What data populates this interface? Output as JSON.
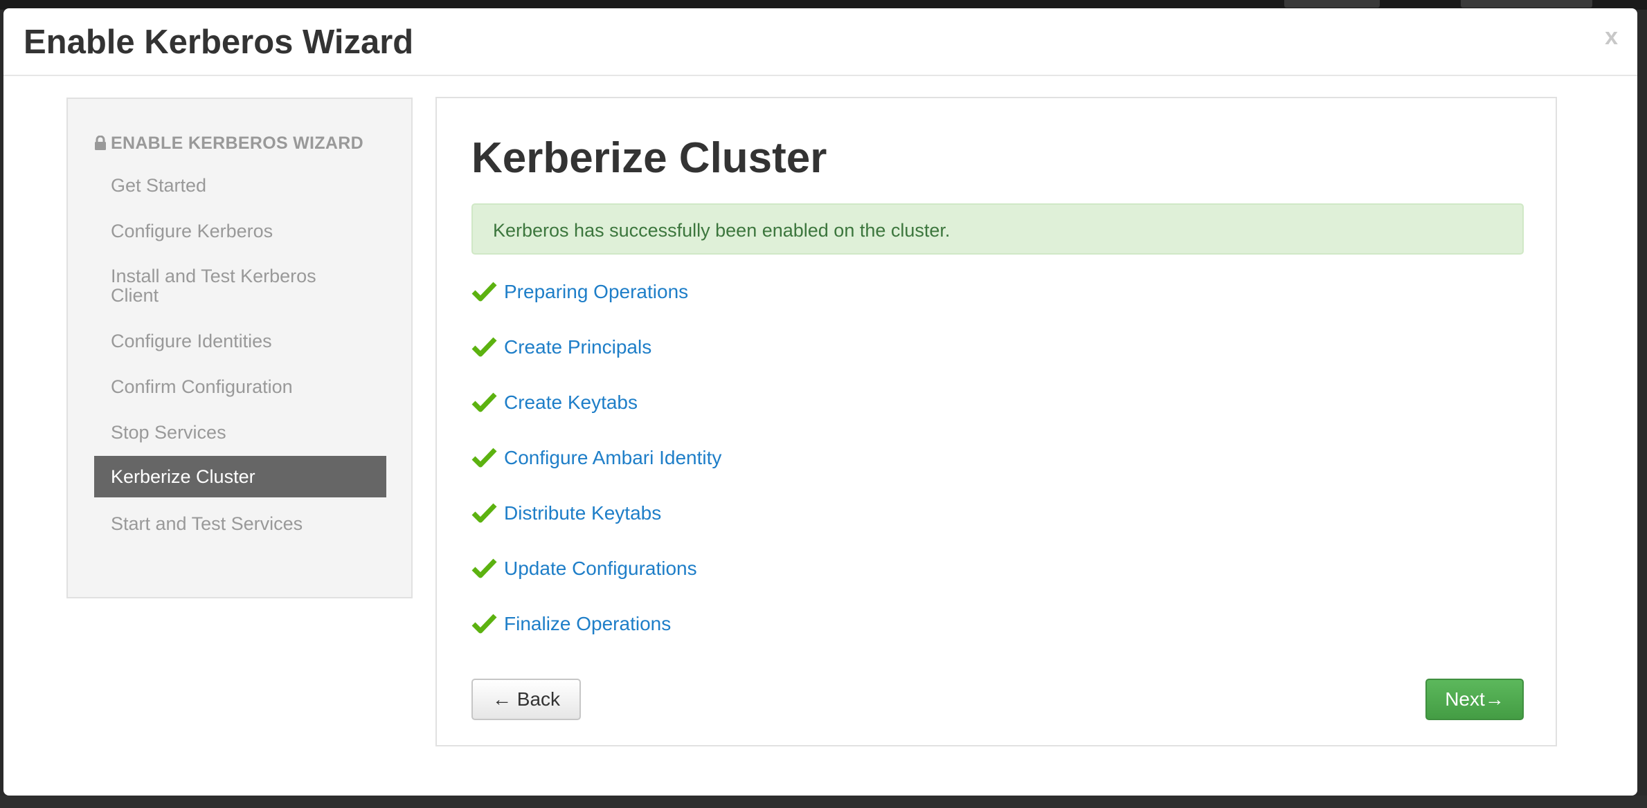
{
  "modal": {
    "title": "Enable Kerberos Wizard",
    "close_label": "x"
  },
  "sidebar": {
    "header": "ENABLE KERBEROS WIZARD",
    "items": [
      {
        "label": "Get Started",
        "active": false
      },
      {
        "label": "Configure Kerberos",
        "active": false
      },
      {
        "label": "Install and Test Kerberos Client",
        "active": false
      },
      {
        "label": "Configure Identities",
        "active": false
      },
      {
        "label": "Confirm Configuration",
        "active": false
      },
      {
        "label": "Stop Services",
        "active": false
      },
      {
        "label": "Kerberize Cluster",
        "active": true
      },
      {
        "label": "Start and Test Services",
        "active": false
      }
    ]
  },
  "main": {
    "title": "Kerberize Cluster",
    "alert": "Kerberos has successfully been enabled on the cluster.",
    "tasks": [
      {
        "label": "Preparing Operations",
        "status": "completed"
      },
      {
        "label": "Create Principals",
        "status": "completed"
      },
      {
        "label": "Create Keytabs",
        "status": "completed"
      },
      {
        "label": "Configure Ambari Identity",
        "status": "completed"
      },
      {
        "label": "Distribute Keytabs",
        "status": "completed"
      },
      {
        "label": "Update Configurations",
        "status": "completed"
      },
      {
        "label": "Finalize Operations",
        "status": "completed"
      }
    ],
    "back_label": "← Back",
    "next_label": "Next→"
  },
  "colors": {
    "success_check": "#5cb210",
    "link": "#1e7ec8",
    "alert_bg": "#dff0d8",
    "alert_text": "#3c763d",
    "next_button": "#5cb85c",
    "active_step_bg": "#666666"
  },
  "icons": {
    "sidebar_header": "lock-icon",
    "task_status": "check-icon"
  }
}
